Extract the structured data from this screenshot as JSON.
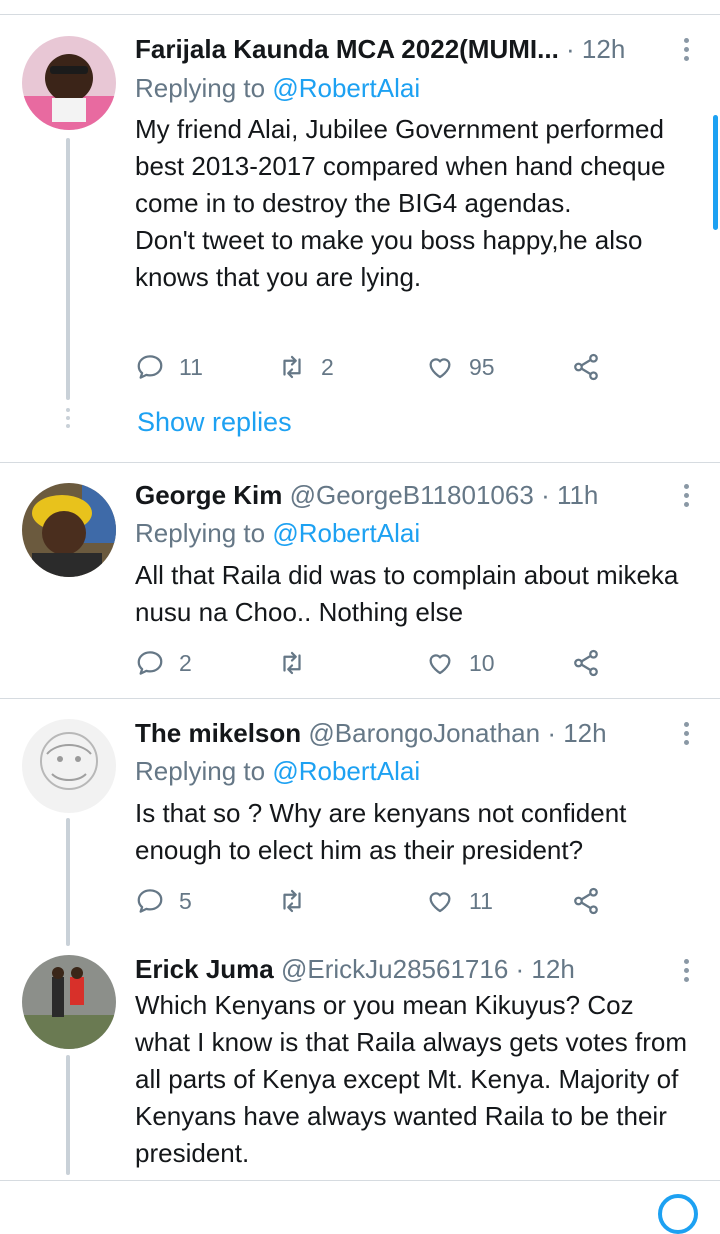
{
  "tweets": [
    {
      "name": "Farijala Kaunda MCA 2022(MUMI...",
      "handle": "",
      "time": "· 12h",
      "replying_label": "Replying to ",
      "replying_user": "@RobertAlai",
      "text": "My friend Alai, Jubilee Government performed best 2013-2017 compared when hand cheque come in to destroy the BIG4 agendas.\nDon't tweet to make you boss happy,he also knows that you are lying.",
      "replies": "11",
      "retweets": "2",
      "likes": "95",
      "show_replies": "Show replies"
    },
    {
      "name": "George Kim",
      "handle": "@GeorgeB11801063",
      "time": "· 11h",
      "replying_label": "Replying to ",
      "replying_user": "@RobertAlai",
      "text": "All that Raila did was to complain about mikeka nusu na Choo.. Nothing else",
      "replies": "2",
      "retweets": "",
      "likes": "10"
    },
    {
      "name": "The mikelson",
      "handle": "@BarongoJonathan",
      "time": "· 12h",
      "replying_label": "Replying to ",
      "replying_user": "@RobertAlai",
      "text": "Is that so ? Why are kenyans not confident enough to elect him as their president?",
      "replies": "5",
      "retweets": "",
      "likes": "11"
    },
    {
      "name": "Erick Juma",
      "handle": "@ErickJu28561716",
      "time": "· 12h",
      "text": "Which Kenyans or you mean Kikuyus? Coz what I know is that Raila always gets votes from all parts of Kenya except Mt. Kenya. Majority of Kenyans have always wanted Raila to be their president."
    }
  ],
  "icons": {
    "reply": "reply-icon",
    "retweet": "retweet-icon",
    "like": "heart-icon",
    "share": "share-icon",
    "more": "more-vertical-icon"
  },
  "colors": {
    "accent": "#1da1f2",
    "secondary_text": "#657786",
    "divider": "#d6dbe0"
  }
}
